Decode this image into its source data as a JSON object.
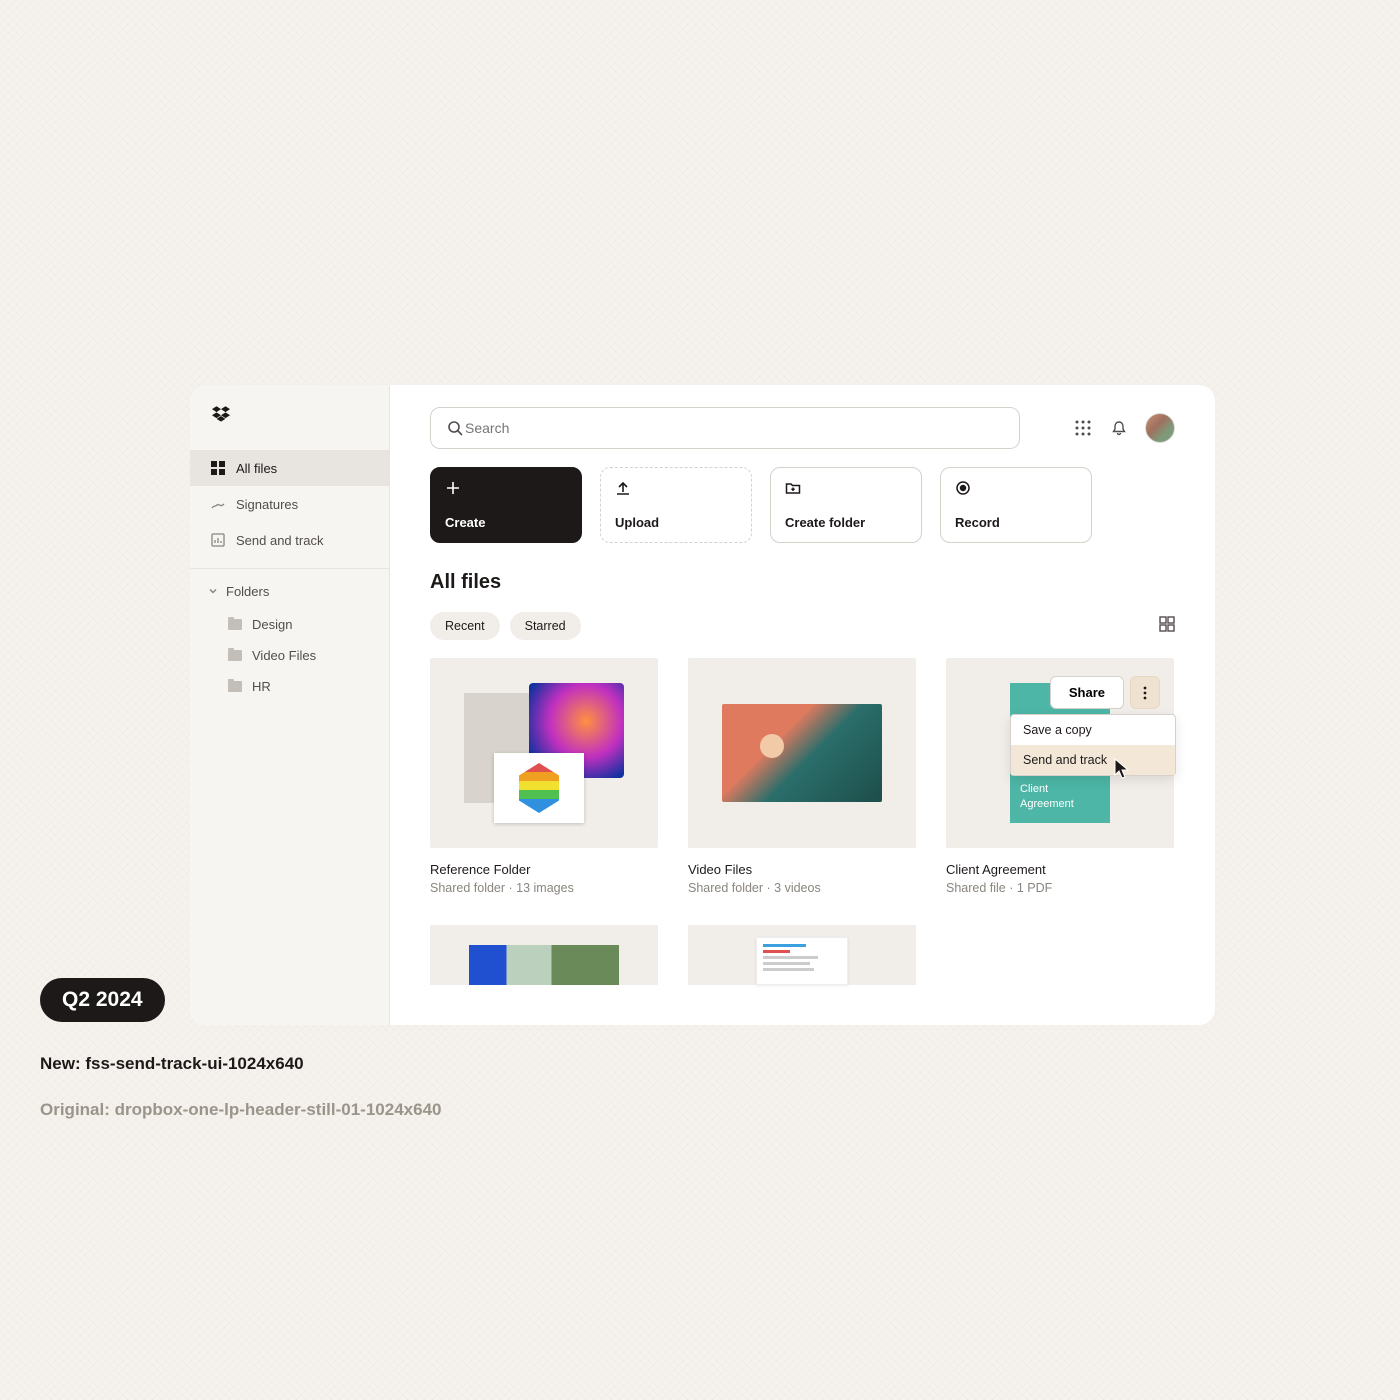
{
  "sidebar": {
    "items": [
      {
        "label": "All files"
      },
      {
        "label": "Signatures"
      },
      {
        "label": "Send and track"
      }
    ],
    "folders_header": "Folders",
    "folders": [
      {
        "label": "Design"
      },
      {
        "label": "Video Files"
      },
      {
        "label": "HR"
      }
    ]
  },
  "search": {
    "placeholder": "Search"
  },
  "actions": {
    "create": "Create",
    "upload": "Upload",
    "create_folder": "Create folder",
    "record": "Record"
  },
  "section_title": "All files",
  "filters": {
    "recent": "Recent",
    "starred": "Starred"
  },
  "files": [
    {
      "title": "Reference Folder",
      "meta": "Shared folder · 13 images"
    },
    {
      "title": "Video Files",
      "meta": "Shared folder · 3 videos"
    },
    {
      "title": "Client Agreement",
      "meta": "Shared file · 1 PDF"
    }
  ],
  "card3": {
    "doc_line1": "Client",
    "doc_line2": "Agreement",
    "share": "Share",
    "menu": {
      "save_copy": "Save a copy",
      "send_track": "Send and track"
    }
  },
  "bottom": {
    "badge": "Q2 2024",
    "new_label": "New: fss-send-track-ui-1024x640",
    "orig_label": "Original: dropbox-one-lp-header-still-01-1024x640"
  }
}
